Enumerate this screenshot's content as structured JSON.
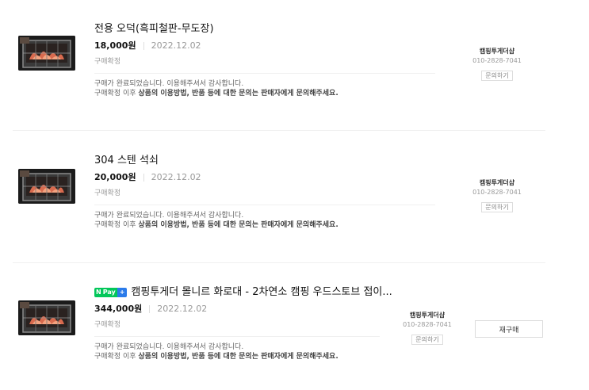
{
  "orders": [
    {
      "title": "전용 오덕(흑피철판-무도장)",
      "npay": false,
      "price": "18,000원",
      "date": "2022.12.02",
      "status": "구매확정",
      "message_line1": "구매가 완료되었습니다. 이용해주셔서 감사합니다.",
      "message_line2_prefix": "구매확정 이후 ",
      "message_line2_bold": "상품의 이용방법, 반품 등에 대한 문의는 판매자에게 문의해주세요.",
      "seller_name": "캠핑투게더샵",
      "seller_phone": "010-2828-7041",
      "ask_label": "문의하기"
    },
    {
      "title": "304 스텐 석쇠",
      "npay": false,
      "price": "20,000원",
      "date": "2022.12.02",
      "status": "구매확정",
      "message_line1": "구매가 완료되었습니다. 이용해주셔서 감사합니다.",
      "message_line2_prefix": "구매확정 이후 ",
      "message_line2_bold": "상품의 이용방법, 반품 등에 대한 문의는 판매자에게 문의해주세요.",
      "seller_name": "캠핑투게더샵",
      "seller_phone": "010-2828-7041",
      "ask_label": "문의하기"
    },
    {
      "title": "캠핑투게더 몰니르 화로대 - 2차연소 캠핑 우드스토브 접이...",
      "npay": true,
      "npay_badge": {
        "n": "N",
        "pay": "Pay",
        "plus": "+"
      },
      "price": "344,000원",
      "date": "2022.12.02",
      "status": "구매확정",
      "message_line1": "구매가 완료되었습니다. 이용해주셔서 감사합니다.",
      "message_line2_prefix": "구매확정 이후 ",
      "message_line2_bold": "상품의 이용방법, 반품 등에 대한 문의는 판매자에게 문의해주세요.",
      "seller_name": "캠핑투게더샵",
      "seller_phone": "010-2828-7041",
      "ask_label": "문의하기",
      "rebuy_label": "재구매"
    }
  ],
  "colors": {
    "npay_green": "#03c75a",
    "npay_blue": "#2b7bea",
    "divider": "#efefef"
  },
  "icons": {
    "product_thumbnail": "wood-stove-photo"
  }
}
